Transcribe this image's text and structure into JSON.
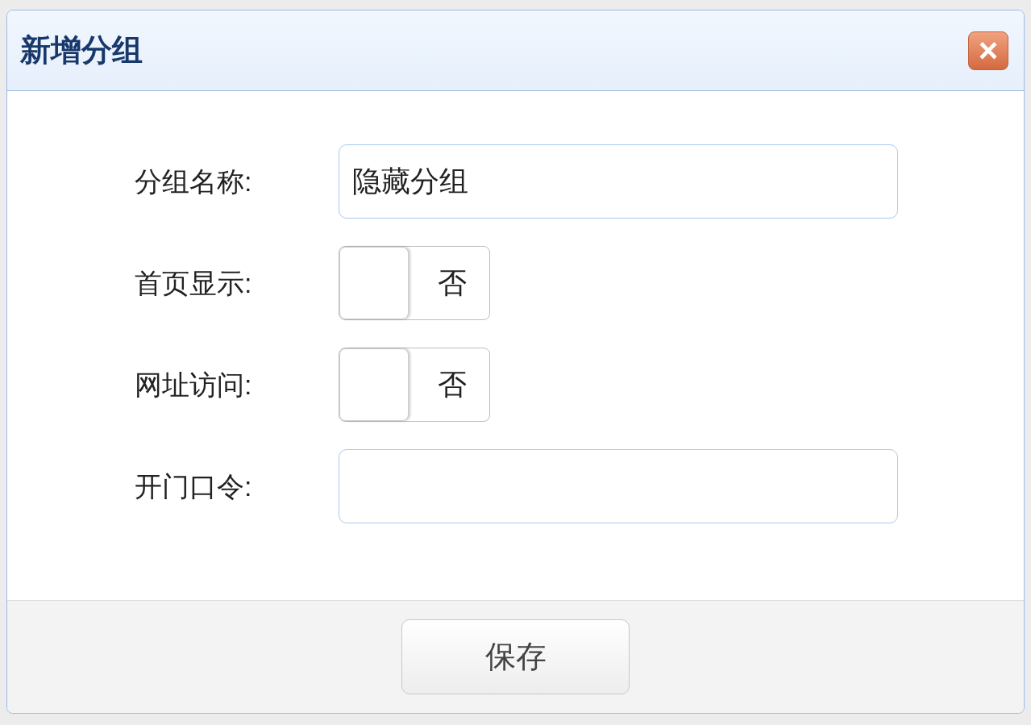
{
  "dialog": {
    "title": "新增分组",
    "close_label": "×"
  },
  "fields": [
    {
      "kind": "text",
      "label": "分组名称:",
      "value": "隐藏分组"
    },
    {
      "kind": "toggle",
      "label": "首页显示:",
      "on": false,
      "state_text": "否"
    },
    {
      "kind": "toggle",
      "label": "网址访问:",
      "on": false,
      "state_text": "否"
    },
    {
      "kind": "text",
      "label": "开门口令:"
    }
  ],
  "buttons": [
    "保存"
  ]
}
